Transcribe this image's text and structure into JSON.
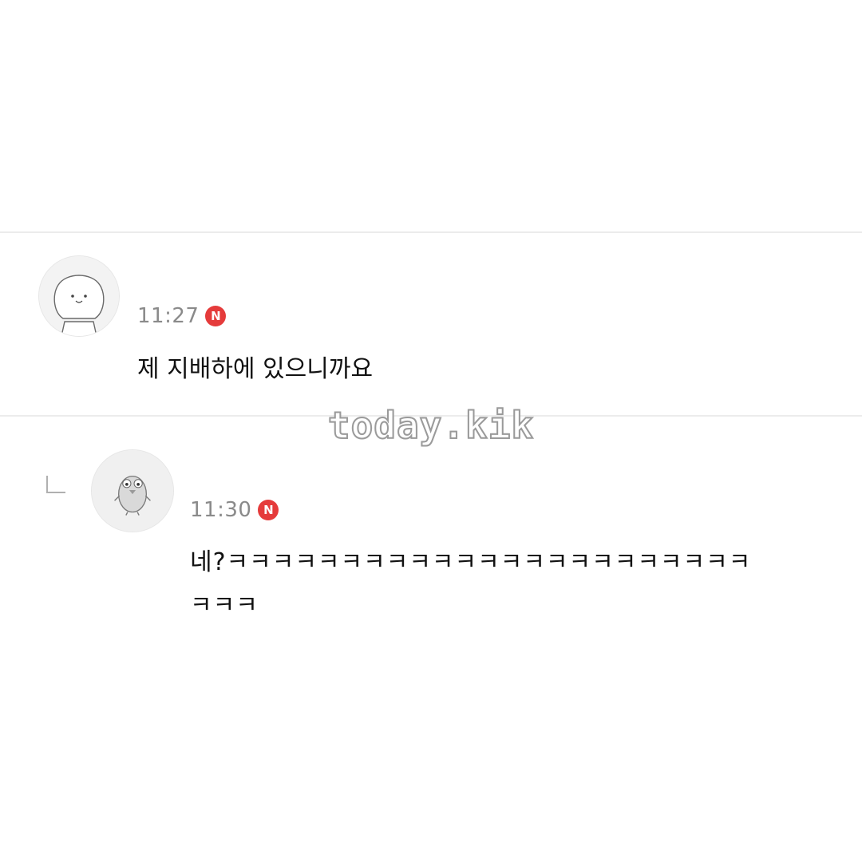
{
  "comments": [
    {
      "avatar_icon": "round-face-character-icon",
      "time": "11:27",
      "badge": "N",
      "text": "제 지배하에 있으니까요"
    },
    {
      "avatar_icon": "bird-character-icon",
      "reply_icon": "reply-arrow-icon",
      "time": "11:30",
      "badge": "N",
      "text_line1": "네?ㅋㅋㅋㅋㅋㅋㅋㅋㅋㅋㅋㅋㅋㅋㅋㅋㅋㅋㅋㅋㅋㅋㅋ",
      "text_line2": "ㅋㅋㅋ"
    }
  ],
  "watermark": "today.kik",
  "colors": {
    "badge": "#e53b3b",
    "time": "#8a8a8a",
    "text": "#111111",
    "divider": "#ececec"
  }
}
